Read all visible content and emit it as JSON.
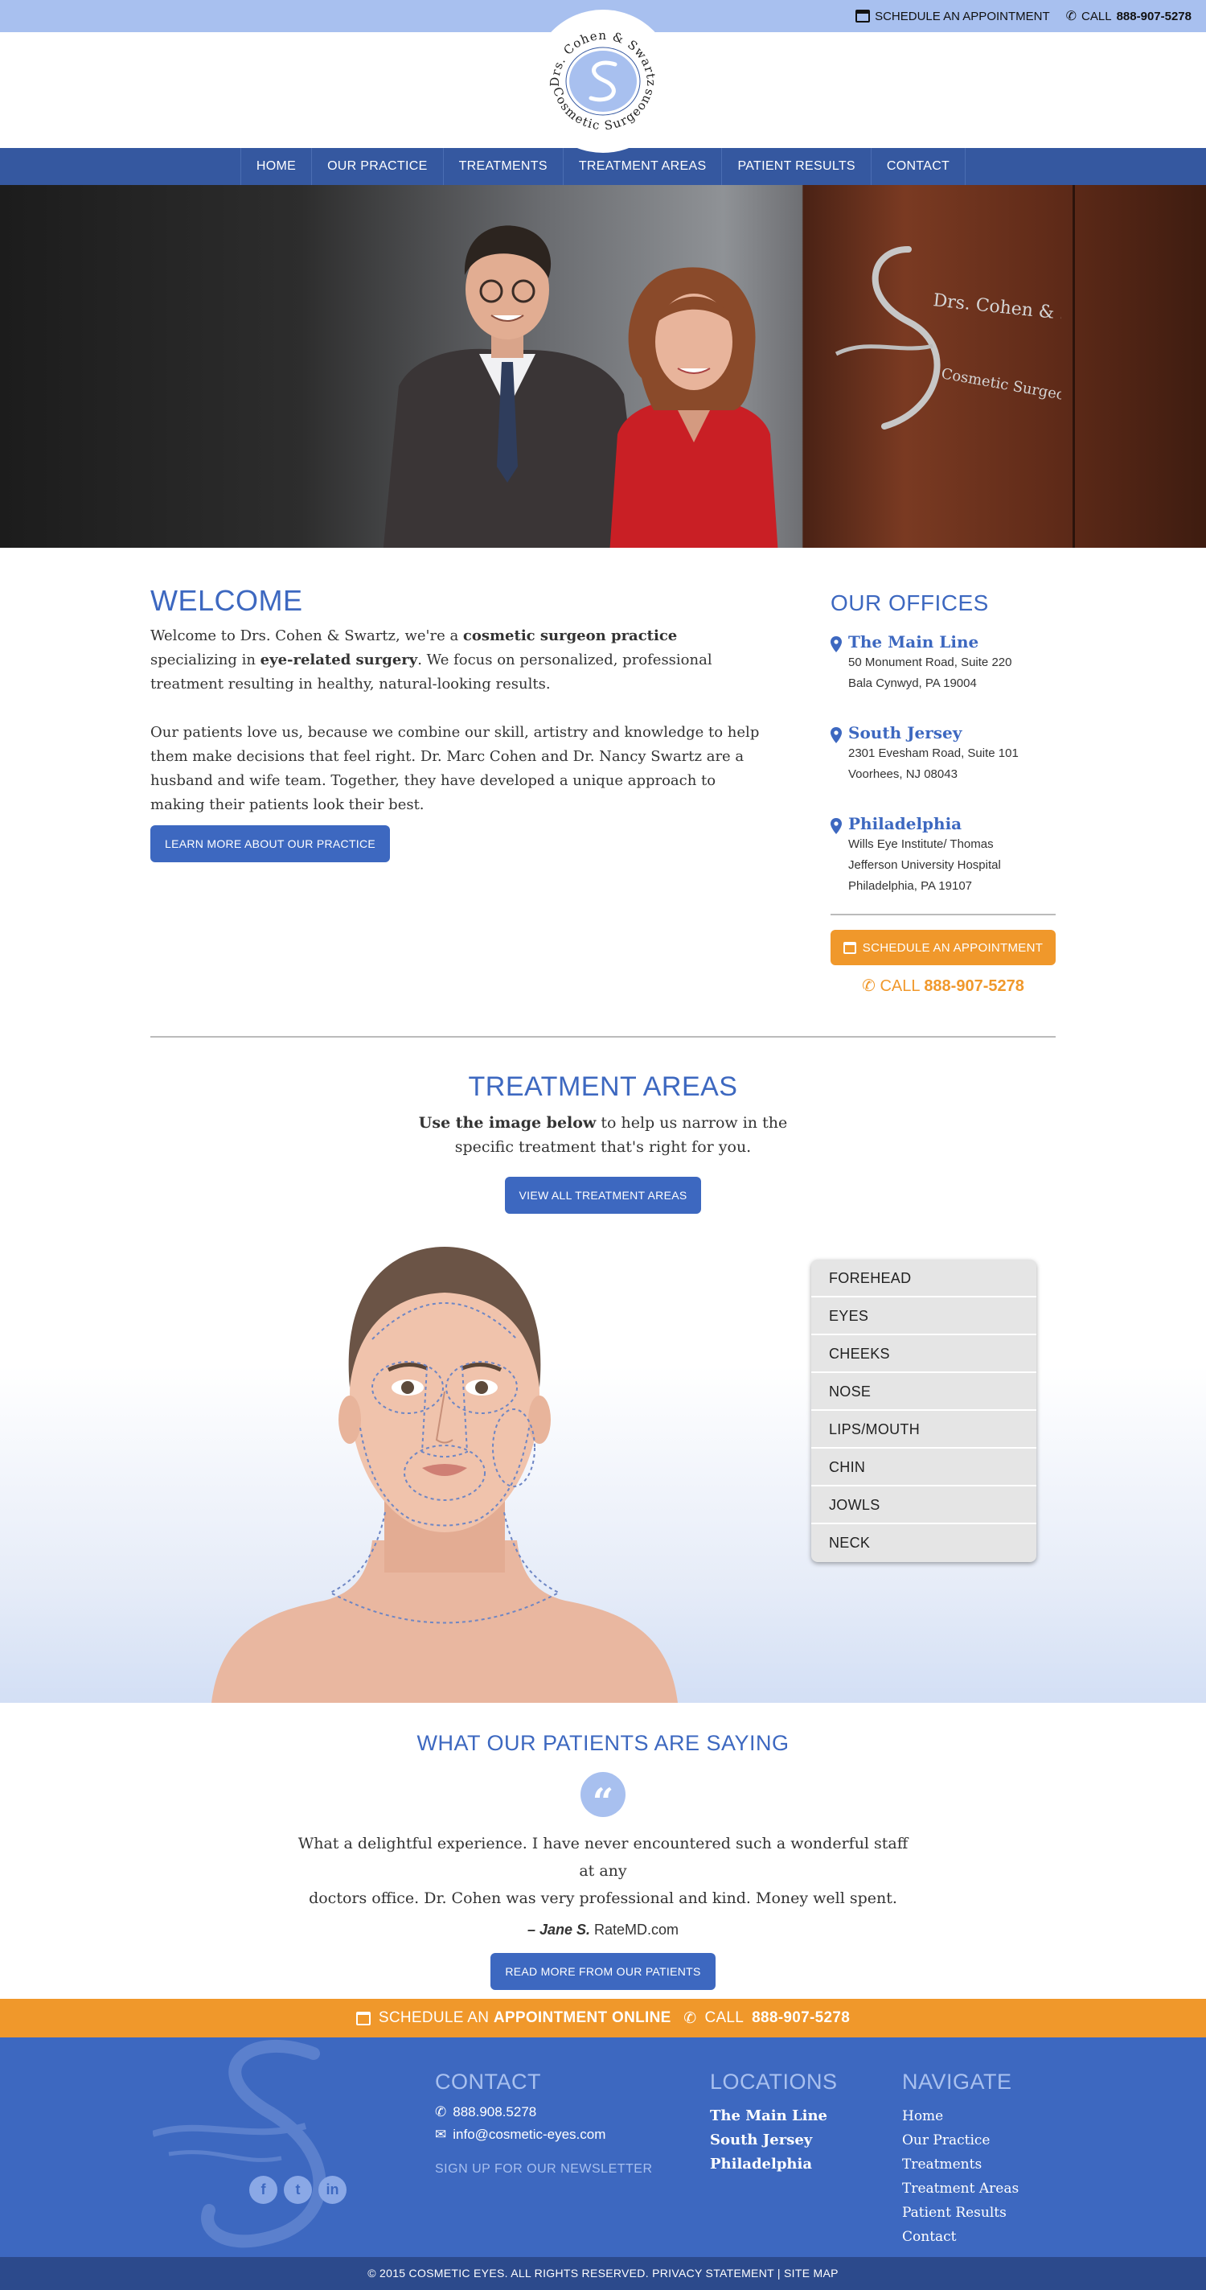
{
  "topbar": {
    "schedule_label": "SCHEDULE AN APPOINTMENT",
    "call_prefix": "CALL",
    "call_number": "888-907-5278"
  },
  "logo": {
    "top_text": "Drs. Cohen & Swartz",
    "bottom_text": "Cosmetic Surgeons"
  },
  "nav": {
    "items": [
      "HOME",
      "OUR PRACTICE",
      "TREATMENTS",
      "TREATMENT AREAS",
      "PATIENT RESULTS",
      "CONTACT"
    ]
  },
  "hero": {
    "sign_top": "Drs. Cohen & Swartz",
    "sign_bottom": "Cosmetic Surgeons"
  },
  "welcome": {
    "title": "WELCOME",
    "p1_a": "Welcome to Drs. Cohen & Swartz, we're a ",
    "p1_b": "cosmetic surgeon practice",
    "p1_c": " specializing in ",
    "p1_d": "eye-related surgery",
    "p1_e": ". We focus on personalized, professional treatment resulting in healthy, natural-looking results.",
    "p2": "Our patients love us, because we combine our skill, artistry and knowledge to help them make decisions that feel right. Dr. Marc Cohen and Dr. Nancy Swartz are a husband and wife team. Together, they have developed a unique approach to making their patients look their best.",
    "button": "LEARN MORE ABOUT OUR PRACTICE"
  },
  "offices": {
    "title": "OUR OFFICES",
    "list": [
      {
        "name": "The Main Line",
        "line1": "50 Monument Road, Suite 220",
        "line2": "Bala Cynwyd, PA 19004",
        "line3": ""
      },
      {
        "name": "South Jersey",
        "line1": "2301 Evesham Road, Suite 101",
        "line2": "Voorhees, NJ 08043",
        "line3": ""
      },
      {
        "name": "Philadelphia",
        "line1": "Wills Eye Institute/ Thomas",
        "line2": "Jefferson University Hospital",
        "line3": "Philadelphia, PA 19107"
      }
    ],
    "schedule_button": "SCHEDULE AN APPOINTMENT",
    "call_prefix": "CALL",
    "call_number": "888-907-5278"
  },
  "treatment_areas": {
    "title": "TREATMENT AREAS",
    "intro_bold": "Use the image below",
    "intro_rest_1": " to help us narrow in the",
    "intro_rest_2": "specific treatment that's right for you.",
    "button": "VIEW ALL TREATMENT AREAS",
    "areas": [
      "FOREHEAD",
      "EYES",
      "CHEEKS",
      "NOSE",
      "LIPS/MOUTH",
      "CHIN",
      "JOWLS",
      "NECK"
    ]
  },
  "testimonials": {
    "title": "WHAT OUR PATIENTS ARE SAYING",
    "quote_glyph": "“",
    "quote_line1": "What a delightful experience. I have never encountered such a wonderful staff at any",
    "quote_line2": "doctors office. Dr. Cohen was very professional and kind. Money well spent.",
    "author": "– Jane S.",
    "source": " RateMD.com",
    "button": "READ MORE FROM OUR PATIENTS"
  },
  "orange_bar": {
    "text_a": "SCHEDULE AN ",
    "text_b": "APPOINTMENT ONLINE",
    "call_prefix": "CALL",
    "call_number": "888-907-5278"
  },
  "footer": {
    "social": [
      "f",
      "t",
      "in"
    ],
    "contact": {
      "title": "CONTACT",
      "phone": "888.908.5278",
      "email": "info@cosmetic-eyes.com",
      "newsletter": "SIGN UP FOR OUR NEWSLETTER"
    },
    "locations": {
      "title": "LOCATIONS",
      "items": [
        "The Main Line",
        "South Jersey",
        "Philadelphia"
      ]
    },
    "navigate": {
      "title": "NAVIGATE",
      "items": [
        "Home",
        "Our Practice",
        "Treatments",
        "Treatment Areas",
        "Patient Results",
        "Contact"
      ]
    },
    "copyright": "© 2015 COSMETIC EYES. ALL RIGHTS RESERVED. PRIVACY STATEMENT | SITE MAP"
  },
  "colors": {
    "primary_blue": "#3d68c0",
    "nav_blue": "#3558a0",
    "light_blue": "#a8c0ef",
    "orange": "#f0982b"
  }
}
